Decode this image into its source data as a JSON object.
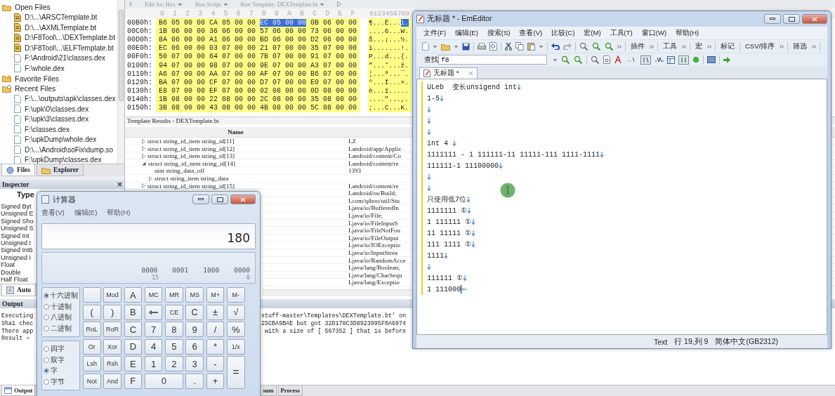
{
  "main_app": {
    "file_panel": {
      "groups": [
        {
          "label": "Open Files",
          "kind": "open",
          "children": [
            {
              "label": "D:\\...\\ARSCTemplate.bt",
              "kind": "template"
            },
            {
              "label": "D:\\...\\AXMLTemplate.bt",
              "kind": "template"
            },
            {
              "label": "D:\\F8Tool\\...\\DEXTemplate.bt",
              "kind": "template"
            },
            {
              "label": "D:\\F8Tool\\...\\ELFTemplate.bt",
              "kind": "template"
            },
            {
              "label": "F:\\Android\\21\\classes.dex",
              "kind": "file"
            },
            {
              "label": "F:\\whole.dex",
              "kind": "file"
            }
          ]
        },
        {
          "label": "Favorite Files",
          "kind": "favorite"
        },
        {
          "label": "Recent Files",
          "kind": "recent",
          "children": [
            {
              "label": "F:\\...\\outputs\\apk\\classes.dex",
              "kind": "file"
            },
            {
              "label": "F:\\upk\\0\\classes.dex",
              "kind": "file"
            },
            {
              "label": "F:\\upk\\3\\classes.dex",
              "kind": "file"
            },
            {
              "label": "F:\\classes.dex",
              "kind": "file"
            },
            {
              "label": "F:\\upkDump\\whole.dex",
              "kind": "file"
            },
            {
              "label": "D:\\...\\Android\\soFix\\dump.so",
              "kind": "file"
            },
            {
              "label": "F:\\upkDump\\classes.dex",
              "kind": "file"
            }
          ]
        }
      ]
    },
    "panel_tabs": [
      {
        "label": "Files",
        "selected": true
      },
      {
        "label": "Explorer",
        "selected": false
      }
    ],
    "inspector": {
      "title": "Inspector",
      "column": "Type",
      "rows": [
        "Signed Byt",
        "Unsigned E",
        "Signed Sho",
        "Unsigned S",
        "Signed Int",
        "Unsigned I",
        "Signed Int6",
        "Unsigned I",
        "Float",
        "Double",
        "Half Float"
      ],
      "tabs": [
        {
          "label": "Auto",
          "selected": true
        }
      ]
    },
    "hex_toolbar": [
      {
        "label": "Edit As: Hex"
      },
      {
        "label": "Run Script"
      },
      {
        "label": "Run Template: DEXTemplate.bt"
      }
    ],
    "hex_view": {
      "column_header": [
        "0",
        "1",
        "2",
        "3",
        "4",
        "5",
        "6",
        "7",
        "8",
        "9",
        "A",
        "B",
        "C",
        "D",
        "E",
        "F"
      ],
      "ascii_header": "0123456789",
      "rows": [
        {
          "offset": "00B0h:",
          "bytes": [
            {
              "text": "B6 05 00 00 CA 05 00 00",
              "selected": false
            },
            {
              "text": "EC 05 00 00",
              "selected": true
            },
            {
              "text": "0B 06 00 00",
              "selected": false
            }
          ],
          "ascii": [
            {
              "text": "¶...Ê...",
              "selected": false
            },
            {
              "text": "ì.",
              "selected": true
            }
          ]
        },
        {
          "offset": "00C0h:",
          "bytes": [
            {
              "text": "1B 06 00 00 36 06 00 00 57 06 00 00 73 06 00 00",
              "selected": false
            }
          ],
          "ascii": [
            {
              "text": "....6...W.",
              "selected": false
            }
          ]
        },
        {
          "offset": "00D0h:",
          "bytes": [
            {
              "text": "8A 06 00 00 A1 06 00 00 BD 06 00 00 D2 06 00 00",
              "selected": false
            }
          ],
          "ascii": [
            {
              "text": "Š...¡...½.",
              "selected": false
            }
          ]
        },
        {
          "offset": "00E0h:",
          "bytes": [
            {
              "text": "EC 06 00 00 03 07 00 00 21 07 00 00 35 07 00 00",
              "selected": false
            }
          ],
          "ascii": [
            {
              "text": "ì.......!.",
              "selected": false
            }
          ]
        },
        {
          "offset": "00F0h:",
          "bytes": [
            {
              "text": "50 07 00 00 64 07 00 00 7B 07 00 00 91 07 00 00",
              "selected": false
            }
          ],
          "ascii": [
            {
              "text": "P...d...{.",
              "selected": false
            }
          ]
        },
        {
          "offset": "0100h:",
          "bytes": [
            {
              "text": "94 07 00 00 98 07 00 00 9E 07 00 00 A3 07 00 00",
              "selected": false
            }
          ],
          "ascii": [
            {
              "text": "”...˜...ž.",
              "selected": false
            }
          ]
        },
        {
          "offset": "0110h:",
          "bytes": [
            {
              "text": "A6 07 00 00 AA 07 00 00 AF 07 00 00 B6 07 00 00",
              "selected": false
            }
          ],
          "ascii": [
            {
              "text": "¦...ª...¯.",
              "selected": false
            }
          ]
        },
        {
          "offset": "0120h:",
          "bytes": [
            {
              "text": "BA 07 00 00 CF 07 00 00 D7 07 00 00 E0 07 00 00",
              "selected": false
            }
          ],
          "ascii": [
            {
              "text": "º...Ï...×.",
              "selected": false
            }
          ]
        },
        {
          "offset": "0130h:",
          "bytes": [
            {
              "text": "E8 07 00 00 EF 07 00 00 02 08 00 00 0D 08 00 00",
              "selected": false
            }
          ],
          "ascii": [
            {
              "text": "è...ï.....",
              "selected": false
            }
          ]
        },
        {
          "offset": "0140h:",
          "bytes": [
            {
              "text": "1B 08 00 00 22 08 00 00 2C 08 00 00 35 08 00 00",
              "selected": false
            }
          ],
          "ascii": [
            {
              "text": "....\"...,.",
              "selected": false
            }
          ]
        },
        {
          "offset": "0150h:",
          "bytes": [
            {
              "text": "3B 08 00 00 43 08 00 00 4B 08 00 00 5C 08 00 00",
              "selected": false
            }
          ],
          "ascii": [
            {
              "text": ";...C...K.",
              "selected": false
            }
          ]
        }
      ]
    },
    "template_results": {
      "title": "Template Results - DEXTemplate.bt",
      "name_column": "Name",
      "rows": [
        {
          "name": "struct string_id_item string_id[11]",
          "value": "LZ",
          "expanded": false
        },
        {
          "name": "struct string_id_item string_id[12]",
          "value": "Landroid/app/Applic",
          "expanded": false
        },
        {
          "name": "struct string_id_item string_id[13]",
          "value": "Landroid/content/Co",
          "expanded": false
        },
        {
          "name": "struct string_id_item string_id[14]",
          "value": "Landroid/content/re",
          "expanded": true,
          "children": [
            {
              "name": "uint string_data_off",
              "value": "1393"
            },
            {
              "name": "struct string_item string_data",
              "expanded": false
            }
          ]
        },
        {
          "name": "struct string_id_item string_id[15]",
          "value": "Landroid/content/re",
          "expanded": false
        },
        {
          "value": "Landroid/os/Build;"
        },
        {
          "value": "Lcom/qihoo/util/Stu"
        },
        {
          "value": "Ljava/io/BufferedIn"
        },
        {
          "value": "Ljava/io/File;"
        },
        {
          "value": "Ljava/io/FileInputS"
        },
        {
          "value": "Ljava/io/FileNotFou"
        },
        {
          "value": "Ljava/io/FileOutput"
        },
        {
          "value": "Ljava/io/IOExceptio"
        },
        {
          "value": "Ljava/io/InputStrea"
        },
        {
          "value": "Ljava/io/RandomAcce"
        },
        {
          "value": "Ljava/lang/Boolean;"
        },
        {
          "value": "Ljava/lang/CharSequ"
        },
        {
          "value": "Ljava/lang/Exceptio"
        }
      ]
    },
    "output": {
      "title": "Output",
      "lines": [
        {
          "left": "Executing",
          "right": "stuff-master\\Templates\\DEXTemplate.bt' on"
        },
        {
          "left": "Sha1 chec",
          "right": "2SCBA9BAE but got 32D178C3D8923995F0A6974"
        },
        {
          "left": "There app",
          "right": " with a size of [ 567352 ] that is before"
        },
        {
          "left": "Result ="
        }
      ]
    },
    "bottom_tabs": [
      {
        "label": "Output",
        "selected": true
      },
      {
        "label": "sum",
        "selected": false
      },
      {
        "label": "Process",
        "selected": false
      }
    ]
  },
  "calculator": {
    "title": "计算器",
    "menu": [
      "查看(V)",
      "编辑(E)",
      "帮助(H)"
    ],
    "display": "180",
    "bits": [
      "0000",
      "0001",
      "1000",
      "0000"
    ],
    "bit_indexes": [
      "15",
      "0"
    ],
    "base_options": [
      {
        "label": "十六进制",
        "selected": true
      },
      {
        "label": "十进制",
        "selected": false
      },
      {
        "label": "八进制",
        "selected": false
      },
      {
        "label": "二进制",
        "selected": false
      }
    ],
    "word_options": [
      {
        "label": "四字",
        "selected": false
      },
      {
        "label": "双字",
        "selected": false
      },
      {
        "label": "字",
        "selected": true
      },
      {
        "label": "字节",
        "selected": false
      }
    ],
    "keys": [
      {
        "kind": "blank"
      },
      {
        "label": "Mod",
        "kind": "key"
      },
      {
        "label": "A",
        "kind": "key"
      },
      {
        "label": "MC",
        "kind": "key"
      },
      {
        "label": "MR",
        "kind": "key"
      },
      {
        "label": "MS",
        "kind": "key"
      },
      {
        "label": "M+",
        "kind": "key"
      },
      {
        "label": "M-",
        "kind": "key"
      },
      {
        "label": "(",
        "kind": "key"
      },
      {
        "label": ")",
        "kind": "key"
      },
      {
        "label": "B",
        "kind": "key"
      },
      {
        "kind": "backspace"
      },
      {
        "label": "CE",
        "kind": "key"
      },
      {
        "label": "C",
        "kind": "key"
      },
      {
        "label": "±",
        "kind": "key"
      },
      {
        "label": "√",
        "kind": "key"
      },
      {
        "label": "RoL",
        "kind": "key"
      },
      {
        "label": "RoR",
        "kind": "key"
      },
      {
        "label": "C",
        "kind": "key"
      },
      {
        "label": "7",
        "kind": "key"
      },
      {
        "label": "8",
        "kind": "key"
      },
      {
        "label": "9",
        "kind": "key"
      },
      {
        "label": "/",
        "kind": "key"
      },
      {
        "label": "%",
        "kind": "key"
      },
      {
        "label": "Or",
        "kind": "key"
      },
      {
        "label": "Xor",
        "kind": "key"
      },
      {
        "label": "D",
        "kind": "key"
      },
      {
        "label": "4",
        "kind": "key"
      },
      {
        "label": "5",
        "kind": "key"
      },
      {
        "label": "6",
        "kind": "key"
      },
      {
        "label": "*",
        "kind": "key"
      },
      {
        "label": "1/x",
        "kind": "key"
      },
      {
        "label": "Lsh",
        "kind": "key"
      },
      {
        "label": "Rsh",
        "kind": "key"
      },
      {
        "label": "E",
        "kind": "key"
      },
      {
        "label": "1",
        "kind": "key"
      },
      {
        "label": "2",
        "kind": "key"
      },
      {
        "label": "3",
        "kind": "key"
      },
      {
        "label": "-",
        "kind": "key"
      },
      {
        "label": "=",
        "kind": "tall"
      },
      {
        "label": "Not",
        "kind": "key"
      },
      {
        "label": "And",
        "kind": "key"
      },
      {
        "label": "F",
        "kind": "key"
      },
      {
        "label": "0",
        "kind": "wide"
      },
      {
        "label": ".",
        "kind": "key"
      },
      {
        "label": "+",
        "kind": "key"
      }
    ]
  },
  "emeditor": {
    "title": "无标题 * - EmEditor",
    "menu": [
      "文件(F)",
      "编辑(E)",
      "搜索(S)",
      "查看(V)",
      "比较(C)",
      "宏(M)",
      "工具(T)",
      "窗口(W)",
      "帮助(H)"
    ],
    "toolbar_labels": [
      "插件",
      "工具",
      "宏",
      "标记",
      "CSV/排序",
      "筛选"
    ],
    "find": {
      "label": "查找",
      "value": "f8"
    },
    "tabs": [
      {
        "label": "无标题 *",
        "selected": true
      }
    ],
    "lines": [
      {
        "text": "ULeb  变长unsigend int",
        "kind": "newline"
      },
      {
        "text": "1-5",
        "kind": "newline"
      },
      {
        "kind": "newline"
      },
      {
        "kind": "newline"
      },
      {
        "kind": "newline"
      },
      {
        "text": "int 4 ",
        "kind": "newline"
      },
      {
        "text": "1111111 - 1 111111-11 11111-111 1111-1111",
        "kind": "newline"
      },
      {
        "text": "111111-1 11100000",
        "kind": "newline"
      },
      {
        "kind": "newline"
      },
      {
        "kind": "newline"
      },
      {
        "text": "只使用低7位",
        "kind": "newline"
      },
      {
        "text": "1111111 ①",
        "kind": "newline"
      },
      {
        "text": "1 111111 ①",
        "kind": "newline"
      },
      {
        "text": "11 11111 ①",
        "kind": "newline"
      },
      {
        "text": "111 1111 ①",
        "kind": "newline"
      },
      {
        "text": "1111",
        "kind": "newline"
      },
      {
        "kind": "newline"
      },
      {
        "text": "111111 ①",
        "kind": "newline"
      },
      {
        "text": "1 111000",
        "kind": "eof"
      }
    ],
    "status": [
      "Text",
      "行 19,列 9",
      "简体中文(GB2312)"
    ]
  }
}
